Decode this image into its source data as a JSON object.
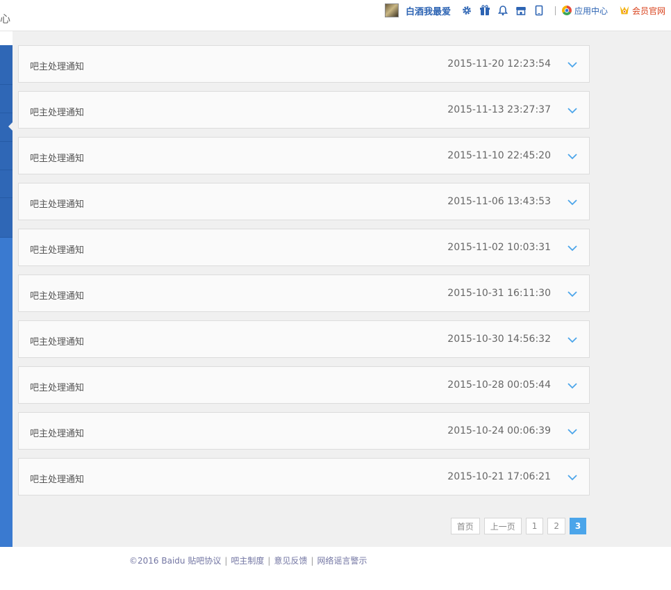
{
  "header": {
    "page_title": "心",
    "username": "白酒我最爱",
    "app_center": "应用中心",
    "vip_site": "会员官网",
    "icons": [
      "settings-gear-icon",
      "gift-icon",
      "bell-icon",
      "store-icon",
      "tablet-icon"
    ]
  },
  "notices": [
    {
      "title": "吧主处理通知",
      "time": "2015-11-20 12:23:54"
    },
    {
      "title": "吧主处理通知",
      "time": "2015-11-13 23:27:37"
    },
    {
      "title": "吧主处理通知",
      "time": "2015-11-10 22:45:20"
    },
    {
      "title": "吧主处理通知",
      "time": "2015-11-06 13:43:53"
    },
    {
      "title": "吧主处理通知",
      "time": "2015-11-02 10:03:31"
    },
    {
      "title": "吧主处理通知",
      "time": "2015-10-31 16:11:30"
    },
    {
      "title": "吧主处理通知",
      "time": "2015-10-30 14:56:32"
    },
    {
      "title": "吧主处理通知",
      "time": "2015-10-28 00:05:44"
    },
    {
      "title": "吧主处理通知",
      "time": "2015-10-24 00:06:39"
    },
    {
      "title": "吧主处理通知",
      "time": "2015-10-21 17:06:21"
    }
  ],
  "pagination": {
    "first": "首页",
    "prev": "上一页",
    "pages": [
      "1",
      "2"
    ],
    "current": "3"
  },
  "footer": {
    "copyright": "©2016 Baidu",
    "links": [
      "贴吧协议",
      "吧主制度",
      "意见反馈",
      "网络谣言警示"
    ]
  },
  "colors": {
    "link_blue": "#2d64b3",
    "nav_blue": "#3a7ad0",
    "pager_active": "#4ba5ea",
    "chevron": "#4ba5ea",
    "vip_red": "#d9421c"
  }
}
